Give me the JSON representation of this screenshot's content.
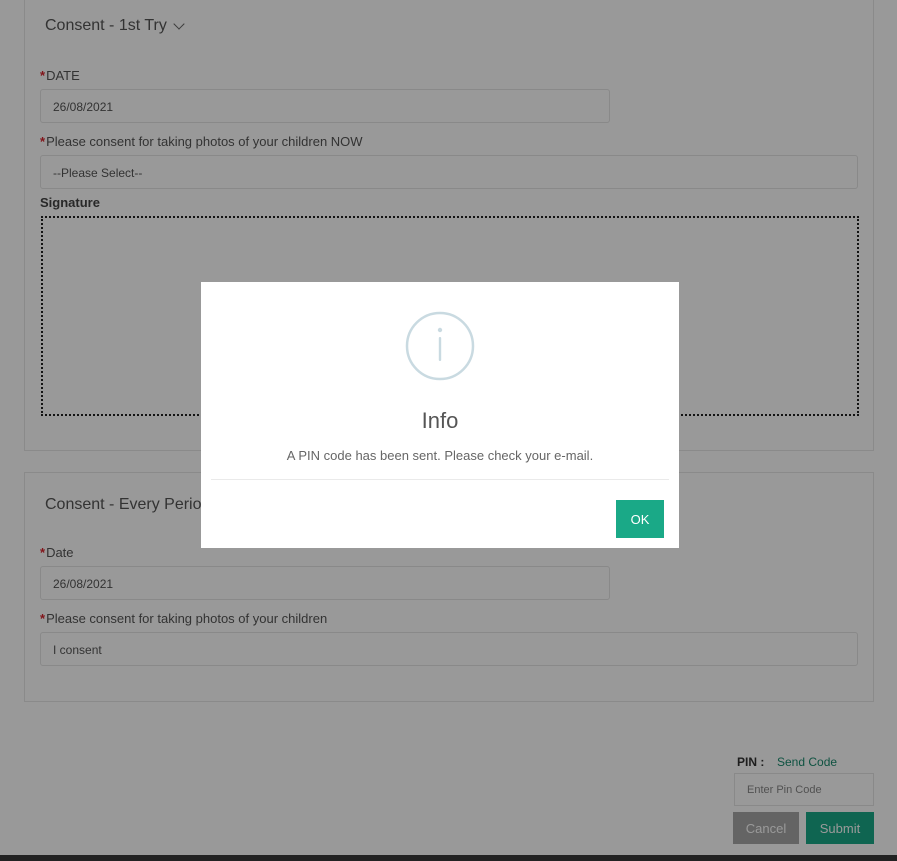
{
  "section1": {
    "title": "Consent - 1st Try",
    "date_label": "DATE",
    "date_value": "26/08/2021",
    "consent_label": "Please consent for taking photos of your children NOW",
    "consent_value": "--Please Select--",
    "signature_label": "Signature"
  },
  "section2": {
    "title": "Consent - Every Period",
    "date_label": "Date",
    "date_value": "26/08/2021",
    "consent_label": "Please consent for taking photos of your children",
    "consent_value": "I consent"
  },
  "pin": {
    "label": "PIN :",
    "send_code": "Send Code",
    "placeholder": "Enter Pin Code"
  },
  "actions": {
    "cancel": "Cancel",
    "submit": "Submit"
  },
  "modal": {
    "icon": "info-circle-icon",
    "title": "Info",
    "message": "A PIN code has been sent. Please check your e-mail.",
    "ok": "OK"
  },
  "colors": {
    "accent": "#1aa987",
    "required": "#d9232d",
    "info_icon": "#c9dae1"
  }
}
